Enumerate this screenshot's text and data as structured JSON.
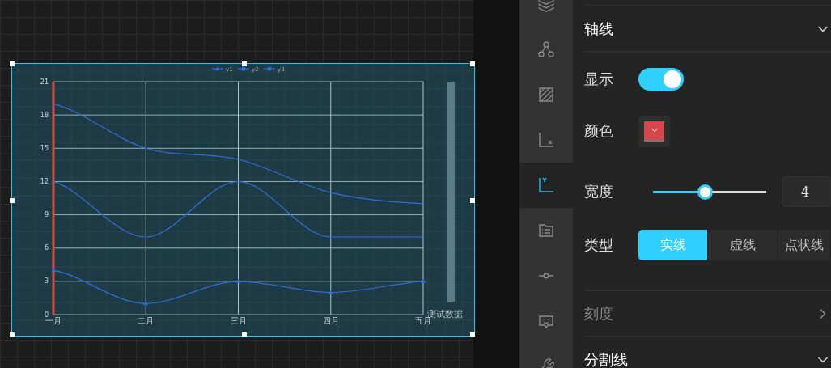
{
  "chart": {
    "chart_data": {
      "type": "line",
      "grid": true,
      "legend": true,
      "xlabel": "测试数据",
      "categories": [
        "一月",
        "二月",
        "三月",
        "四月",
        "五月"
      ],
      "ylim": [
        0,
        21
      ],
      "yticks": [
        0,
        3,
        6,
        9,
        12,
        15,
        18,
        21
      ],
      "series": [
        {
          "name": "y1",
          "color": "#2f6fd6",
          "marker": "triangle",
          "values": [
            4,
            1,
            3,
            2,
            3
          ]
        },
        {
          "name": "y2",
          "color": "#2f6fd6",
          "values": [
            12,
            7,
            12,
            7,
            7
          ]
        },
        {
          "name": "y3",
          "color": "#2f6fd6",
          "values": [
            19,
            15,
            14,
            11,
            10
          ]
        }
      ]
    }
  },
  "sidebar": {
    "items": [
      {
        "kind": "layers",
        "selected": false
      },
      {
        "kind": "nodes",
        "selected": false
      },
      {
        "kind": "area",
        "selected": false
      },
      {
        "kind": "xaxis",
        "selected": false
      },
      {
        "kind": "yaxis",
        "selected": true
      },
      {
        "kind": "legend",
        "selected": false
      },
      {
        "kind": "marker",
        "selected": false
      },
      {
        "kind": "tooltip",
        "selected": false
      },
      {
        "kind": "tools",
        "selected": false
      }
    ]
  },
  "panel": {
    "sections": [
      {
        "kind": "group",
        "title": "轴线",
        "expanded": true,
        "disabled": false,
        "rows": [
          {
            "kind": "toggle",
            "label": "显示",
            "on": true
          },
          {
            "kind": "color",
            "label": "颜色",
            "color": "#d6474d"
          },
          {
            "kind": "slider",
            "label": "宽度",
            "level": 0.4,
            "value": "4"
          },
          {
            "kind": "segments",
            "label": "类型",
            "options": [
              {
                "label": "实线",
                "selected": true
              },
              {
                "label": "虚线",
                "selected": false
              },
              {
                "label": "点状线",
                "selected": false
              }
            ]
          }
        ]
      },
      {
        "kind": "group",
        "title": "刻度",
        "expanded": false,
        "disabled": true
      },
      {
        "kind": "group",
        "title": "分割线",
        "expanded": true,
        "disabled": false
      }
    ]
  }
}
